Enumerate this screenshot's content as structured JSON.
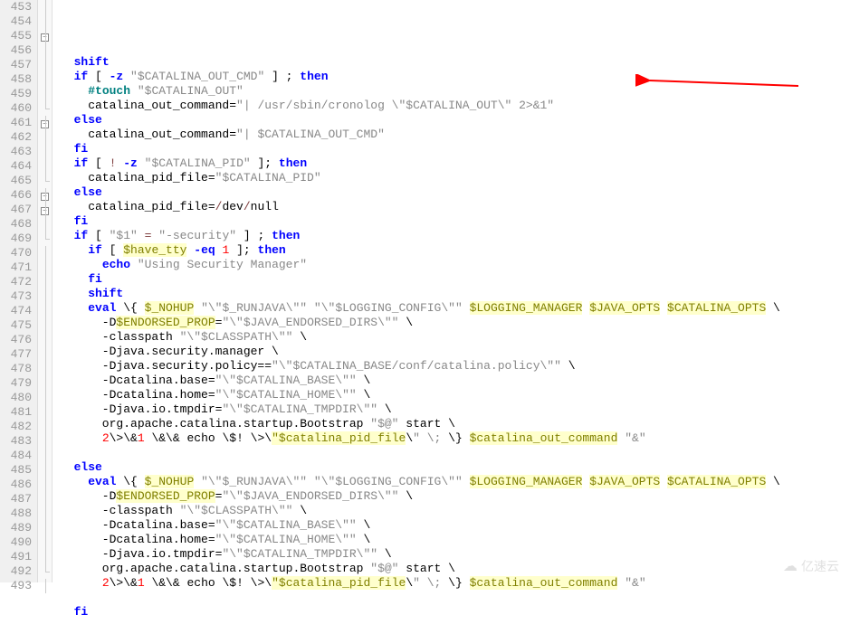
{
  "lines": [
    {
      "n": 453,
      "fold": "v",
      "seg": [
        {
          "t": "  ",
          "c": ""
        }
      ]
    },
    {
      "n": 454,
      "fold": "v",
      "seg": [
        {
          "t": "  ",
          "c": ""
        },
        {
          "t": "shift",
          "c": "kw"
        }
      ]
    },
    {
      "n": 455,
      "fold": "box",
      "seg": [
        {
          "t": "  ",
          "c": ""
        },
        {
          "t": "if",
          "c": "kw"
        },
        {
          "t": " [ ",
          "c": ""
        },
        {
          "t": "-z",
          "c": "kw"
        },
        {
          "t": " ",
          "c": ""
        },
        {
          "t": "\"$CATALINA_OUT_CMD\"",
          "c": "str"
        },
        {
          "t": " ] ; ",
          "c": ""
        },
        {
          "t": "then",
          "c": "kw"
        }
      ]
    },
    {
      "n": 456,
      "fold": "v",
      "seg": [
        {
          "t": "    ",
          "c": ""
        },
        {
          "t": "#touch",
          "c": "comment"
        },
        {
          "t": " ",
          "c": ""
        },
        {
          "t": "\"$CATALINA_OUT\"",
          "c": "str"
        }
      ]
    },
    {
      "n": 457,
      "fold": "v",
      "seg": [
        {
          "t": "    catalina_out_command=",
          "c": ""
        },
        {
          "t": "\"| /usr/sbin/cronolog \\\"$CATALINA_OUT\\\" 2>&1\"",
          "c": "str"
        }
      ]
    },
    {
      "n": 458,
      "fold": "v",
      "seg": [
        {
          "t": "  ",
          "c": ""
        },
        {
          "t": "else",
          "c": "kw"
        }
      ]
    },
    {
      "n": 459,
      "fold": "v",
      "seg": [
        {
          "t": "    catalina_out_command=",
          "c": ""
        },
        {
          "t": "\"| $CATALINA_OUT_CMD\"",
          "c": "str"
        }
      ]
    },
    {
      "n": 460,
      "fold": "end",
      "seg": [
        {
          "t": "  ",
          "c": ""
        },
        {
          "t": "fi",
          "c": "kw"
        }
      ]
    },
    {
      "n": 461,
      "fold": "box",
      "seg": [
        {
          "t": "  ",
          "c": ""
        },
        {
          "t": "if",
          "c": "kw"
        },
        {
          "t": " [ ",
          "c": ""
        },
        {
          "t": "!",
          "c": "op"
        },
        {
          "t": " ",
          "c": ""
        },
        {
          "t": "-z",
          "c": "kw"
        },
        {
          "t": " ",
          "c": ""
        },
        {
          "t": "\"$CATALINA_PID\"",
          "c": "str"
        },
        {
          "t": " ]; ",
          "c": ""
        },
        {
          "t": "then",
          "c": "kw"
        }
      ]
    },
    {
      "n": 462,
      "fold": "v",
      "seg": [
        {
          "t": "    catalina_pid_file=",
          "c": ""
        },
        {
          "t": "\"$CATALINA_PID\"",
          "c": "str"
        }
      ]
    },
    {
      "n": 463,
      "fold": "v",
      "seg": [
        {
          "t": "  ",
          "c": ""
        },
        {
          "t": "else",
          "c": "kw"
        }
      ]
    },
    {
      "n": 464,
      "fold": "v",
      "seg": [
        {
          "t": "    catalina_pid_file=",
          "c": ""
        },
        {
          "t": "/",
          "c": "op"
        },
        {
          "t": "dev",
          "c": ""
        },
        {
          "t": "/",
          "c": "op"
        },
        {
          "t": "null",
          "c": ""
        }
      ]
    },
    {
      "n": 465,
      "fold": "end",
      "seg": [
        {
          "t": "  ",
          "c": ""
        },
        {
          "t": "fi",
          "c": "kw"
        }
      ]
    },
    {
      "n": 466,
      "fold": "box",
      "seg": [
        {
          "t": "  ",
          "c": ""
        },
        {
          "t": "if",
          "c": "kw"
        },
        {
          "t": " [ ",
          "c": ""
        },
        {
          "t": "\"$1\"",
          "c": "str"
        },
        {
          "t": " ",
          "c": ""
        },
        {
          "t": "=",
          "c": "op"
        },
        {
          "t": " ",
          "c": ""
        },
        {
          "t": "\"-security\"",
          "c": "str"
        },
        {
          "t": " ] ; ",
          "c": ""
        },
        {
          "t": "then",
          "c": "kw"
        }
      ]
    },
    {
      "n": 467,
      "fold": "box",
      "seg": [
        {
          "t": "    ",
          "c": ""
        },
        {
          "t": "if",
          "c": "kw"
        },
        {
          "t": " [ ",
          "c": ""
        },
        {
          "t": "$have_tty",
          "c": "var-hl"
        },
        {
          "t": " ",
          "c": ""
        },
        {
          "t": "-eq",
          "c": "kw"
        },
        {
          "t": " ",
          "c": ""
        },
        {
          "t": "1",
          "c": "num"
        },
        {
          "t": " ]; ",
          "c": ""
        },
        {
          "t": "then",
          "c": "kw"
        }
      ]
    },
    {
      "n": 468,
      "fold": "v",
      "seg": [
        {
          "t": "      ",
          "c": ""
        },
        {
          "t": "echo",
          "c": "kw"
        },
        {
          "t": " ",
          "c": ""
        },
        {
          "t": "\"Using Security Manager\"",
          "c": "str"
        }
      ]
    },
    {
      "n": 469,
      "fold": "end",
      "seg": [
        {
          "t": "    ",
          "c": ""
        },
        {
          "t": "fi",
          "c": "kw"
        }
      ]
    },
    {
      "n": 470,
      "fold": "v",
      "seg": [
        {
          "t": "    ",
          "c": ""
        },
        {
          "t": "shift",
          "c": "kw"
        }
      ]
    },
    {
      "n": 471,
      "fold": "v",
      "seg": [
        {
          "t": "    ",
          "c": ""
        },
        {
          "t": "eval",
          "c": "kw"
        },
        {
          "t": " \\{ ",
          "c": ""
        },
        {
          "t": "$_NOHUP",
          "c": "var-hl"
        },
        {
          "t": " ",
          "c": ""
        },
        {
          "t": "\"\\\"$_RUNJAVA\\\"\"",
          "c": "str"
        },
        {
          "t": " ",
          "c": ""
        },
        {
          "t": "\"\\\"$LOGGING_CONFIG\\\"\"",
          "c": "str"
        },
        {
          "t": " ",
          "c": ""
        },
        {
          "t": "$LOGGING_MANAGER",
          "c": "var-hl"
        },
        {
          "t": " ",
          "c": ""
        },
        {
          "t": "$JAVA_OPTS",
          "c": "var-hl"
        },
        {
          "t": " ",
          "c": ""
        },
        {
          "t": "$CATALINA_OPTS",
          "c": "var-hl"
        },
        {
          "t": " \\",
          "c": ""
        }
      ]
    },
    {
      "n": 472,
      "fold": "v",
      "seg": [
        {
          "t": "      -D",
          "c": ""
        },
        {
          "t": "$ENDORSED_PROP",
          "c": "var-hl"
        },
        {
          "t": "=",
          "c": ""
        },
        {
          "t": "\"\\\"$JAVA_ENDORSED_DIRS\\\"\"",
          "c": "str"
        },
        {
          "t": " \\",
          "c": ""
        }
      ]
    },
    {
      "n": 473,
      "fold": "v",
      "seg": [
        {
          "t": "      -classpath ",
          "c": ""
        },
        {
          "t": "\"\\\"$CLASSPATH\\\"\"",
          "c": "str"
        },
        {
          "t": " \\",
          "c": ""
        }
      ]
    },
    {
      "n": 474,
      "fold": "v",
      "seg": [
        {
          "t": "      -Djava.security.manager \\",
          "c": ""
        }
      ]
    },
    {
      "n": 475,
      "fold": "v",
      "seg": [
        {
          "t": "      -Djava.security.policy==",
          "c": ""
        },
        {
          "t": "\"\\\"$CATALINA_BASE/conf/catalina.policy\\\"\"",
          "c": "str"
        },
        {
          "t": " \\",
          "c": ""
        }
      ]
    },
    {
      "n": 476,
      "fold": "v",
      "seg": [
        {
          "t": "      -Dcatalina.base=",
          "c": ""
        },
        {
          "t": "\"\\\"$CATALINA_BASE\\\"\"",
          "c": "str"
        },
        {
          "t": " \\",
          "c": ""
        }
      ]
    },
    {
      "n": 477,
      "fold": "v",
      "seg": [
        {
          "t": "      -Dcatalina.home=",
          "c": ""
        },
        {
          "t": "\"\\\"$CATALINA_HOME\\\"\"",
          "c": "str"
        },
        {
          "t": " \\",
          "c": ""
        }
      ]
    },
    {
      "n": 478,
      "fold": "v",
      "seg": [
        {
          "t": "      -Djava.io.tmpdir=",
          "c": ""
        },
        {
          "t": "\"\\\"$CATALINA_TMPDIR\\\"\"",
          "c": "str"
        },
        {
          "t": " \\",
          "c": ""
        }
      ]
    },
    {
      "n": 479,
      "fold": "v",
      "seg": [
        {
          "t": "      org.apache.catalina.startup.Bootstrap ",
          "c": ""
        },
        {
          "t": "\"$@\"",
          "c": "str"
        },
        {
          "t": " start \\",
          "c": ""
        }
      ]
    },
    {
      "n": 480,
      "fold": "v",
      "seg": [
        {
          "t": "      ",
          "c": ""
        },
        {
          "t": "2",
          "c": "num"
        },
        {
          "t": "\\>\\&",
          "c": ""
        },
        {
          "t": "1",
          "c": "num"
        },
        {
          "t": " \\&\\& echo \\$! \\>\\",
          "c": ""
        },
        {
          "t": "\"$catalina_pid_file",
          "c": "var-hl"
        },
        {
          "t": "\\",
          "c": ""
        },
        {
          "t": "\" \\;",
          "c": "str"
        },
        {
          "t": " \\} ",
          "c": ""
        },
        {
          "t": "$catalina_out_command",
          "c": "var-hl"
        },
        {
          "t": " ",
          "c": ""
        },
        {
          "t": "\"&\"",
          "c": "str"
        }
      ]
    },
    {
      "n": 481,
      "fold": "v",
      "seg": [
        {
          "t": "",
          "c": ""
        }
      ]
    },
    {
      "n": 482,
      "fold": "v",
      "seg": [
        {
          "t": "  ",
          "c": ""
        },
        {
          "t": "else",
          "c": "kw"
        }
      ]
    },
    {
      "n": 483,
      "fold": "v",
      "seg": [
        {
          "t": "    ",
          "c": ""
        },
        {
          "t": "eval",
          "c": "kw"
        },
        {
          "t": " \\{ ",
          "c": ""
        },
        {
          "t": "$_NOHUP",
          "c": "var-hl"
        },
        {
          "t": " ",
          "c": ""
        },
        {
          "t": "\"\\\"$_RUNJAVA\\\"\"",
          "c": "str"
        },
        {
          "t": " ",
          "c": ""
        },
        {
          "t": "\"\\\"$LOGGING_CONFIG\\\"\"",
          "c": "str"
        },
        {
          "t": " ",
          "c": ""
        },
        {
          "t": "$LOGGING_MANAGER",
          "c": "var-hl"
        },
        {
          "t": " ",
          "c": ""
        },
        {
          "t": "$JAVA_OPTS",
          "c": "var-hl"
        },
        {
          "t": " ",
          "c": ""
        },
        {
          "t": "$CATALINA_OPTS",
          "c": "var-hl"
        },
        {
          "t": " \\",
          "c": ""
        }
      ]
    },
    {
      "n": 484,
      "fold": "v",
      "seg": [
        {
          "t": "      -D",
          "c": ""
        },
        {
          "t": "$ENDORSED_PROP",
          "c": "var-hl"
        },
        {
          "t": "=",
          "c": ""
        },
        {
          "t": "\"\\\"$JAVA_ENDORSED_DIRS\\\"\"",
          "c": "str"
        },
        {
          "t": " \\",
          "c": ""
        }
      ]
    },
    {
      "n": 485,
      "fold": "v",
      "seg": [
        {
          "t": "      -classpath ",
          "c": ""
        },
        {
          "t": "\"\\\"$CLASSPATH\\\"\"",
          "c": "str"
        },
        {
          "t": " \\",
          "c": ""
        }
      ]
    },
    {
      "n": 486,
      "fold": "v",
      "seg": [
        {
          "t": "      -Dcatalina.base=",
          "c": ""
        },
        {
          "t": "\"\\\"$CATALINA_BASE\\\"\"",
          "c": "str"
        },
        {
          "t": " \\",
          "c": ""
        }
      ]
    },
    {
      "n": 487,
      "fold": "v",
      "seg": [
        {
          "t": "      -Dcatalina.home=",
          "c": ""
        },
        {
          "t": "\"\\\"$CATALINA_HOME\\\"\"",
          "c": "str"
        },
        {
          "t": " \\",
          "c": ""
        }
      ]
    },
    {
      "n": 488,
      "fold": "v",
      "seg": [
        {
          "t": "      -Djava.io.tmpdir=",
          "c": ""
        },
        {
          "t": "\"\\\"$CATALINA_TMPDIR\\\"\"",
          "c": "str"
        },
        {
          "t": " \\",
          "c": ""
        }
      ]
    },
    {
      "n": 489,
      "fold": "v",
      "seg": [
        {
          "t": "      org.apache.catalina.startup.Bootstrap ",
          "c": ""
        },
        {
          "t": "\"$@\"",
          "c": "str"
        },
        {
          "t": " start \\",
          "c": ""
        }
      ]
    },
    {
      "n": 490,
      "fold": "v",
      "seg": [
        {
          "t": "      ",
          "c": ""
        },
        {
          "t": "2",
          "c": "num"
        },
        {
          "t": "\\>\\&",
          "c": ""
        },
        {
          "t": "1",
          "c": "num"
        },
        {
          "t": " \\&\\& echo \\$! \\>\\",
          "c": ""
        },
        {
          "t": "\"$catalina_pid_file",
          "c": "var-hl"
        },
        {
          "t": "\\",
          "c": ""
        },
        {
          "t": "\" \\;",
          "c": "str"
        },
        {
          "t": " \\} ",
          "c": ""
        },
        {
          "t": "$catalina_out_command",
          "c": "var-hl"
        },
        {
          "t": " ",
          "c": ""
        },
        {
          "t": "\"&\"",
          "c": "str"
        }
      ]
    },
    {
      "n": 491,
      "fold": "v",
      "seg": [
        {
          "t": "",
          "c": ""
        }
      ]
    },
    {
      "n": 492,
      "fold": "end",
      "seg": [
        {
          "t": "  ",
          "c": ""
        },
        {
          "t": "fi",
          "c": "kw"
        }
      ]
    },
    {
      "n": 493,
      "fold": "v",
      "seg": [
        {
          "t": "",
          "c": ""
        }
      ]
    }
  ],
  "watermark": {
    "text": "亿速云"
  }
}
